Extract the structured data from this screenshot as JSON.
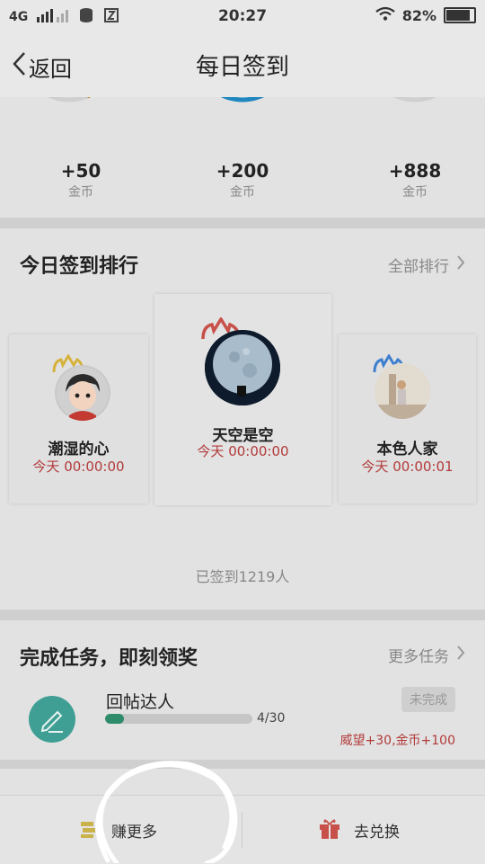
{
  "status_bar": {
    "network": "4G",
    "time": "20:27",
    "battery_percent": "82%",
    "battery_level": 0.82
  },
  "nav": {
    "back_label": "返回",
    "title": "每日签到"
  },
  "rewards": [
    {
      "value": "+50",
      "unit": "金币",
      "color": "#c77a1a"
    },
    {
      "value": "+200",
      "unit": "金币",
      "color": "#1f86bf"
    },
    {
      "value": "+888",
      "unit": "金币",
      "color": "#bdbdbd"
    }
  ],
  "ranking": {
    "title": "今日签到排行",
    "link_label": "全部排行",
    "signed_count": "已签到1219人",
    "entries": [
      {
        "name": "潮湿的心",
        "time": "今天 00:00:00",
        "crown_color": "#d6b23c"
      },
      {
        "name": "天空是空",
        "time": "今天 00:00:00",
        "crown_color": "#c8504a"
      },
      {
        "name": "本色人家",
        "time": "今天 00:00:01",
        "crown_color": "#3f7fcf"
      }
    ]
  },
  "tasks": {
    "title": "完成任务，即刻领奖",
    "link_label": "更多任务",
    "items": [
      {
        "name": "回帖达人",
        "progress_text": "4/30",
        "progress": 0.133,
        "status": "未完成",
        "reward": "威望+30,金币+100"
      }
    ]
  },
  "bottom_bar": {
    "earn_label": "赚更多",
    "exchange_label": "去兑换"
  }
}
